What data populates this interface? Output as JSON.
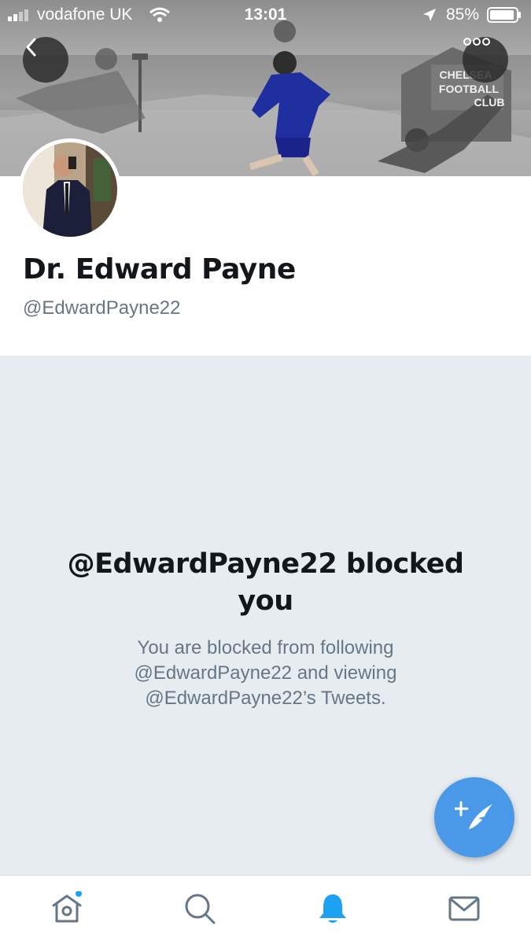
{
  "status_bar": {
    "carrier": "vodafone UK",
    "time": "13:01",
    "battery": "85%"
  },
  "header": {
    "banner_text": "CHELSEA FOOTBALL CLUB"
  },
  "profile": {
    "name": "Dr. Edward Payne",
    "handle": "@EdwardPayne22"
  },
  "blocked": {
    "title": "@EdwardPayne22 blocked you",
    "description": "You are blocked from following @EdwardPayne22 and viewing @EdwardPayne22’s Tweets."
  },
  "tab_bar": {
    "items": [
      {
        "name": "home",
        "icon": "home-icon",
        "has_dot": true
      },
      {
        "name": "search",
        "icon": "search-icon"
      },
      {
        "name": "notifications",
        "icon": "bell-icon",
        "active": true
      },
      {
        "name": "messages",
        "icon": "envelope-icon"
      }
    ]
  },
  "colors": {
    "accent": "#1da1f2",
    "fab": "#4a99e9",
    "panel_bg": "#e6ecf0",
    "secondary_text": "#657786"
  }
}
